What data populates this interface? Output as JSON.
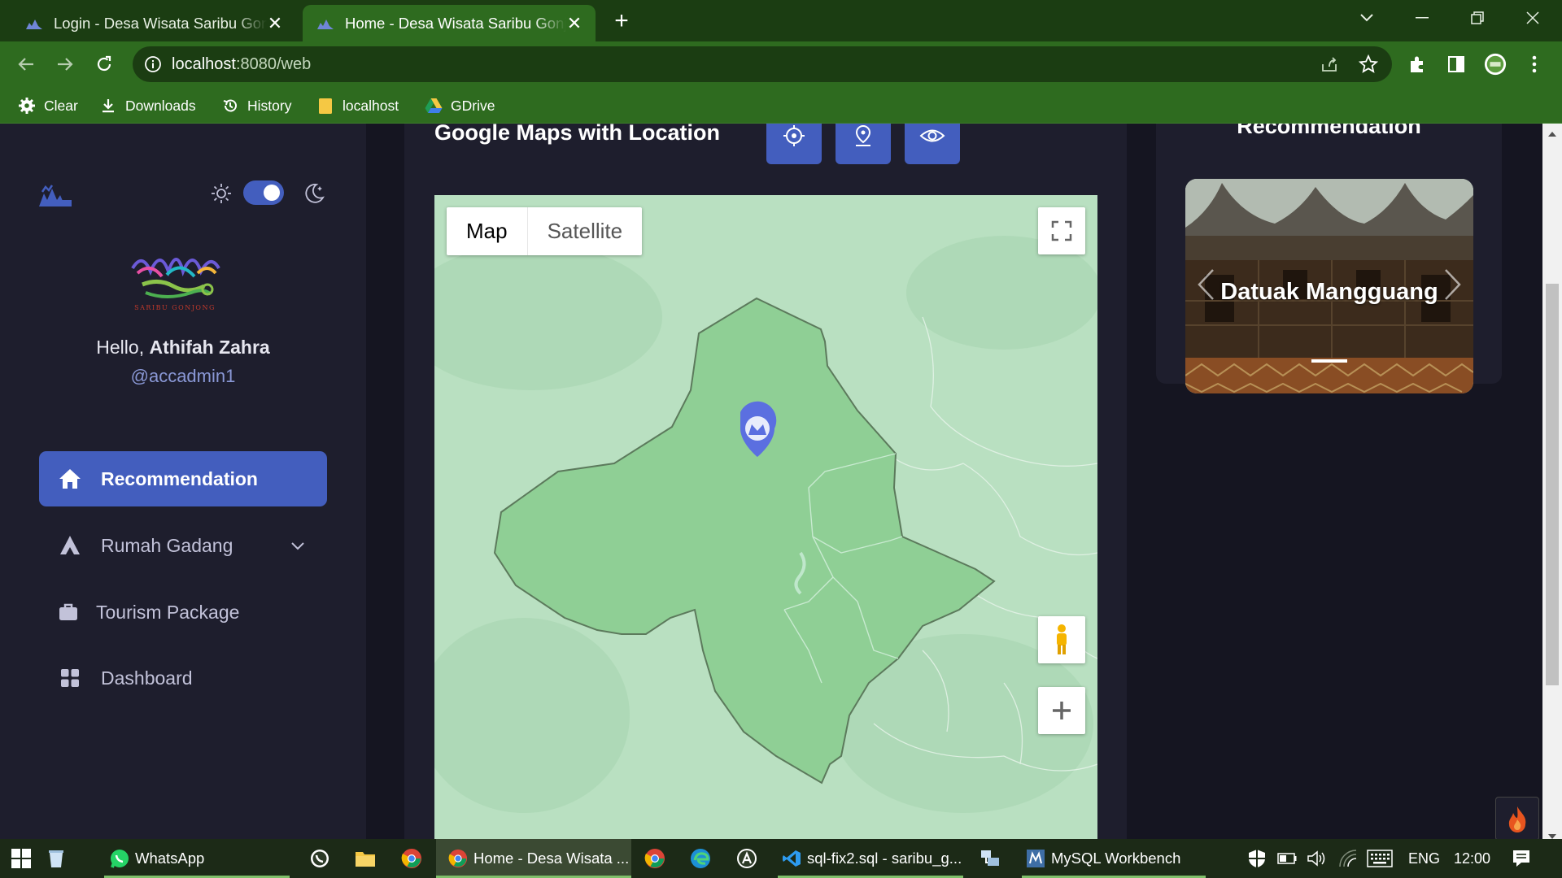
{
  "browser": {
    "tabs": [
      {
        "title": "Login - Desa Wisata Saribu Gonjong",
        "active": false
      },
      {
        "title": "Home - Desa Wisata Saribu Gonjong",
        "active": true
      }
    ],
    "url_host": "localhost",
    "url_path": ":8080/web",
    "bookmarks": [
      "Clear",
      "Downloads",
      "History",
      "localhost",
      "GDrive"
    ]
  },
  "sidebar": {
    "brand_text": "SARIBU GONJONG",
    "greeting_prefix": "Hello, ",
    "user_name": "Athifah Zahra",
    "user_handle": "@accadmin1",
    "menu": [
      {
        "label": "Recommendation",
        "icon": "home-icon",
        "active": true
      },
      {
        "label": "Rumah Gadang",
        "icon": "hiking-icon",
        "active": false
      },
      {
        "label": "Tourism Package",
        "icon": "briefcase-icon",
        "active": false
      },
      {
        "label": "Dashboard",
        "icon": "grid-icon",
        "active": false
      }
    ]
  },
  "map_card": {
    "title": "Google Maps with Location",
    "map_type_options": [
      "Map",
      "Satellite"
    ],
    "selected_map_type": "Map"
  },
  "recommendation": {
    "title": "Recommendation",
    "slides": [
      {
        "caption": "Datuak Mangguang"
      }
    ]
  },
  "taskbar": {
    "items": [
      "WhatsApp",
      "Home - Desa Wisata ...",
      "sql-fix2.sql - saribu_g...",
      "MySQL Workbench"
    ],
    "language": "ENG",
    "time": "12:00"
  },
  "colors": {
    "accent": "#435ebe",
    "browser_frame": "#1b3d12",
    "browser_toolbar": "#2e6b1f",
    "sidebar_bg": "#1e1e2d",
    "map_land": "#b9e0c1",
    "district_fill": "#8fcf95"
  }
}
